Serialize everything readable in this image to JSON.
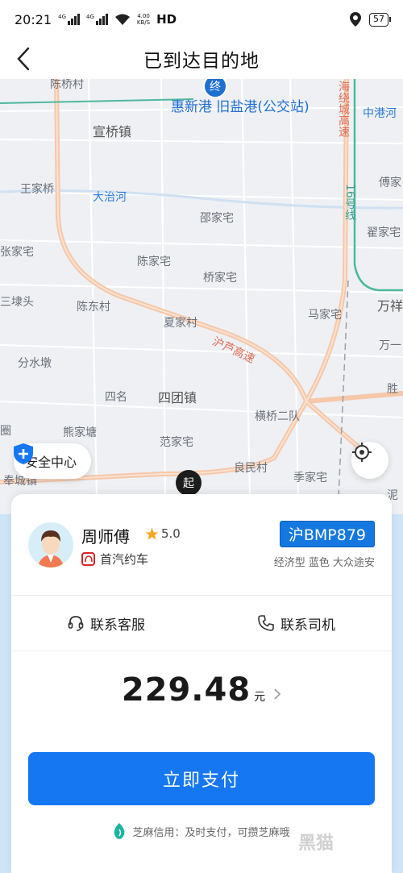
{
  "status_bar": {
    "time": "20:21",
    "net1": "4G",
    "net2": "4G",
    "speed_value": "4.00",
    "speed_unit": "KB/S",
    "hd": "HD",
    "battery": "57"
  },
  "header": {
    "title": "已到达目的地"
  },
  "map": {
    "end_marker": "终",
    "start_marker": "起",
    "destination": "惠新港  旧盐港(公交站)",
    "labels": {
      "top_village": "陈桥村",
      "zhonggang": "中港河",
      "xuanqiao": "宣桥镇",
      "wangjiaqiao": "王家桥",
      "dazhihe": "大治河",
      "shaojiazhai": "邵家宅",
      "chuanjiazhai": "傅家",
      "zhaijiazhai": "翟家宅",
      "zhangjiazhai": "张家宅",
      "chenjiazhai": "陈家宅",
      "qiaojiazhai": "桥家宅",
      "majiazhai": "马家宅",
      "sandaitou": "三埭头",
      "chendongcun": "陈东村",
      "xiajiacun": "夏家村",
      "wanxiang": "万祥",
      "fenshuidun": "分水墩",
      "wanyi": "万一",
      "sheng": "胜",
      "siming": "四名",
      "situanzhen": "四团镇",
      "hengqiao": "横桥二队",
      "juan": "圈",
      "xiongjiatang": "熊家塘",
      "fanjiazhai": "范家宅",
      "liangmincun": "良民村",
      "fengcheng": "奉城镇",
      "jijiazhai": "季家宅",
      "ni": "泥"
    },
    "roads": {
      "hulu": "沪芦高速",
      "haiyang": "海绕城高速",
      "line16": "16号线"
    }
  },
  "safety": {
    "label": "安全中心"
  },
  "driver": {
    "name": "周师傅",
    "rating": "5.0",
    "company": "首汽约车",
    "plate": "沪BMP879",
    "car_info": "经济型 蓝色 大众途安"
  },
  "contact": {
    "service_label": "联系客服",
    "driver_label": "联系司机"
  },
  "price": {
    "amount": "229.48",
    "unit": "元"
  },
  "pay": {
    "label": "立即支付"
  },
  "credit": {
    "text": "芝麻信用：及时支付，可攒芝麻哦"
  },
  "watermark": "黑猫",
  "colors": {
    "primary": "#1677f2",
    "plate": "#1478e0",
    "road": "#f6c7a8",
    "route": "#1e6fd0"
  }
}
